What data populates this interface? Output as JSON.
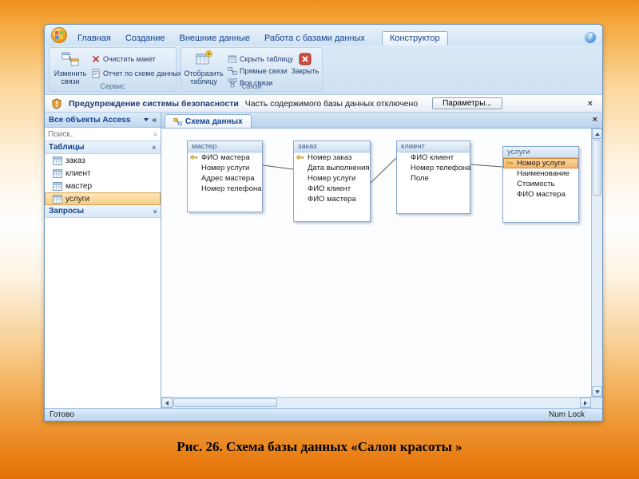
{
  "caption": "Рис. 26.  Схема базы данных «Салон красоты »",
  "colors": {
    "selection_orange": "#f6b469",
    "ribbon_blue": "#dbe9f7",
    "key_gold": "#c79b2e",
    "close_red": "#cf4a41"
  },
  "ribbon_tabs": [
    {
      "label": "Главная"
    },
    {
      "label": "Создание"
    },
    {
      "label": "Внешние данные"
    },
    {
      "label": "Работа с базами данных"
    },
    {
      "label": "Конструктор"
    }
  ],
  "ribbon": {
    "tools_group": {
      "label": "Сервис",
      "edit_relationships": "Изменить связи",
      "clear_layout": "Очистить макет",
      "relationships_report": "Отчет по схеме данных"
    },
    "relationships_group": {
      "label": "Связи",
      "show_table": "Отобразить таблицу",
      "hide_table": "Скрыть таблицу",
      "direct_relationships": "Прямые связи",
      "all_relationships": "Все связи",
      "close": "Закрыть"
    }
  },
  "security_bar": {
    "title": "Предупреждение системы безопасности",
    "message": "Часть содержимого базы данных отключено",
    "options_button": "Параметры..."
  },
  "nav": {
    "header": "Все объекты Access",
    "search_placeholder": "Поиск..",
    "tables_section": "Таблицы",
    "queries_section": "Запросы",
    "tables": [
      {
        "label": "заказ"
      },
      {
        "label": "клиент"
      },
      {
        "label": "мастер"
      },
      {
        "label": "услуги",
        "selected": true
      }
    ]
  },
  "document": {
    "tab_label": "Схема данных",
    "tables": [
      {
        "name": "мастер",
        "fields": [
          {
            "name": "ФИО мастера",
            "key": true
          },
          {
            "name": "Номер услуги",
            "key": false
          },
          {
            "name": "Адрес мастера",
            "key": false
          },
          {
            "name": "Номер телефона",
            "key": false
          }
        ]
      },
      {
        "name": "заказ",
        "fields": [
          {
            "name": "Номер заказ",
            "key": true
          },
          {
            "name": "Дата выполнения",
            "key": false
          },
          {
            "name": "Номер услуги",
            "key": false
          },
          {
            "name": "ФИО клиент",
            "key": false
          },
          {
            "name": "ФИО мастера",
            "key": false
          }
        ]
      },
      {
        "name": "клиент",
        "fields": [
          {
            "name": "ФИО клиент",
            "key": false
          },
          {
            "name": "Номер телефона",
            "key": false
          },
          {
            "name": "Поле",
            "key": false
          }
        ]
      },
      {
        "name": "услуги",
        "fields": [
          {
            "name": "Номер услуги",
            "key": true,
            "selected": true
          },
          {
            "name": "Наименование",
            "key": false
          },
          {
            "name": "Стоимость",
            "key": false
          },
          {
            "name": "ФИО мастера",
            "key": false
          }
        ]
      }
    ]
  },
  "status": {
    "left": "Готово",
    "right": "Num Lock"
  }
}
